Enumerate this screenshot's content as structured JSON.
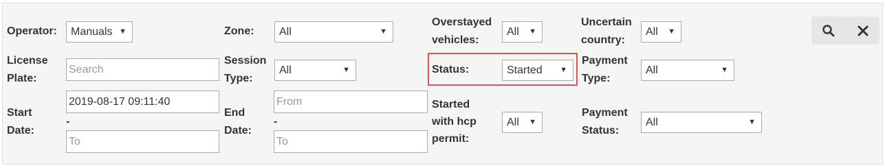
{
  "filters": {
    "operator": {
      "label": "Operator:",
      "value": "Manuals"
    },
    "zone": {
      "label": "Zone:",
      "value": "All"
    },
    "overstayed": {
      "label_line1": "Overstayed",
      "label_line2": "vehicles:",
      "value": "All"
    },
    "uncertain_country": {
      "label_line1": "Uncertain",
      "label_line2": "country:",
      "value": "All"
    },
    "license_plate": {
      "label_line1": "License",
      "label_line2": "Plate:",
      "placeholder": "Search"
    },
    "session_type": {
      "label_line1": "Session",
      "label_line2": "Type:",
      "value": "All"
    },
    "status": {
      "label": "Status:",
      "value": "Started"
    },
    "payment_type": {
      "label_line1": "Payment",
      "label_line2": "Type:",
      "value": "All"
    },
    "start_date": {
      "label_line1": "Start",
      "label_line2": "Date:",
      "from_value": "2019-08-17 09:11:40",
      "separator": "-",
      "to_placeholder": "To"
    },
    "end_date": {
      "label_line1": "End",
      "label_line2": "Date:",
      "from_placeholder": "From",
      "separator": "-",
      "to_placeholder": "To"
    },
    "hcp_permit": {
      "label_line1": "Started",
      "label_line2": "with hcp",
      "label_line3": "permit:",
      "value": "All"
    },
    "payment_status": {
      "label_line1": "Payment",
      "label_line2": "Status:",
      "value": "All"
    }
  },
  "actions": {
    "search_icon": "magnifier-icon",
    "clear_icon": "close-icon"
  },
  "colors": {
    "panel_bg": "#f5f5f5",
    "highlight_border": "#d9534f",
    "button_bg": "#e6e6e6"
  }
}
